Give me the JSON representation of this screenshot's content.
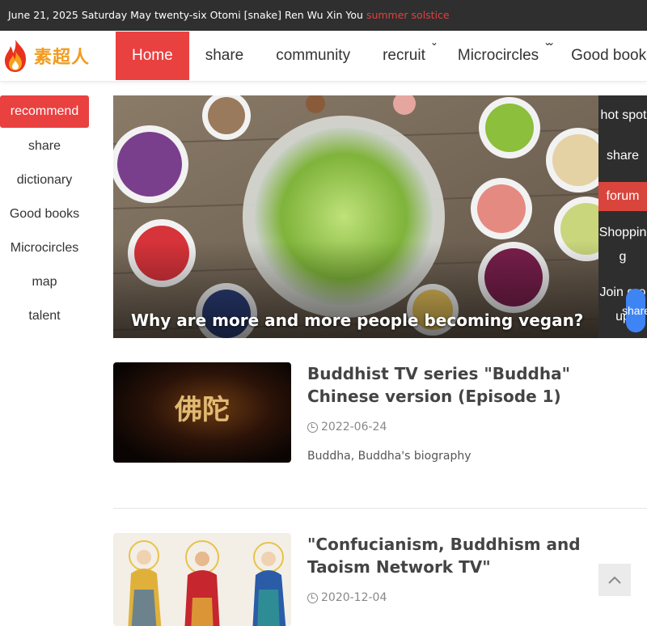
{
  "topbar": {
    "text": "June 21, 2025 Saturday May twenty-six Otomi [snake] Ren Wu Xin You",
    "solar_term": "summer solstice"
  },
  "logo": {
    "text": "素超人",
    "icon": "flame-icon"
  },
  "nav": {
    "items": [
      {
        "label": "Home",
        "active": true
      },
      {
        "label": "share"
      },
      {
        "label": "community"
      },
      {
        "label": "recruit",
        "dropdown": true
      },
      {
        "label": "Microcircles",
        "dropdown": true
      },
      {
        "label": "Good books",
        "dropdown": true
      }
    ]
  },
  "sidebar": {
    "items": [
      "recommend",
      "share",
      "dictionary",
      "Good books",
      "Microcircles",
      "map",
      "talent"
    ]
  },
  "hero": {
    "caption": "Why are more and more people becoming vegan?"
  },
  "float_menu": {
    "items": [
      "hot spot",
      "share",
      "forum",
      "Shopping",
      "Join group"
    ],
    "share_button": "share"
  },
  "articles": [
    {
      "title": "Buddhist TV series \"Buddha\" Chinese version (Episode 1)",
      "date": "2022-06-24",
      "tags": "Buddha, Buddha's biography",
      "thumb_text": "佛陀"
    },
    {
      "title": "\"Confucianism, Buddhism and Taoism Network TV\"",
      "date": "2020-12-04"
    }
  ],
  "colors": {
    "accent": "#e94040",
    "topbar": "#2f2f2f",
    "logo": "#f29b1d",
    "float_bg": "#2e2e2e",
    "share_blue": "#3e84f4"
  }
}
